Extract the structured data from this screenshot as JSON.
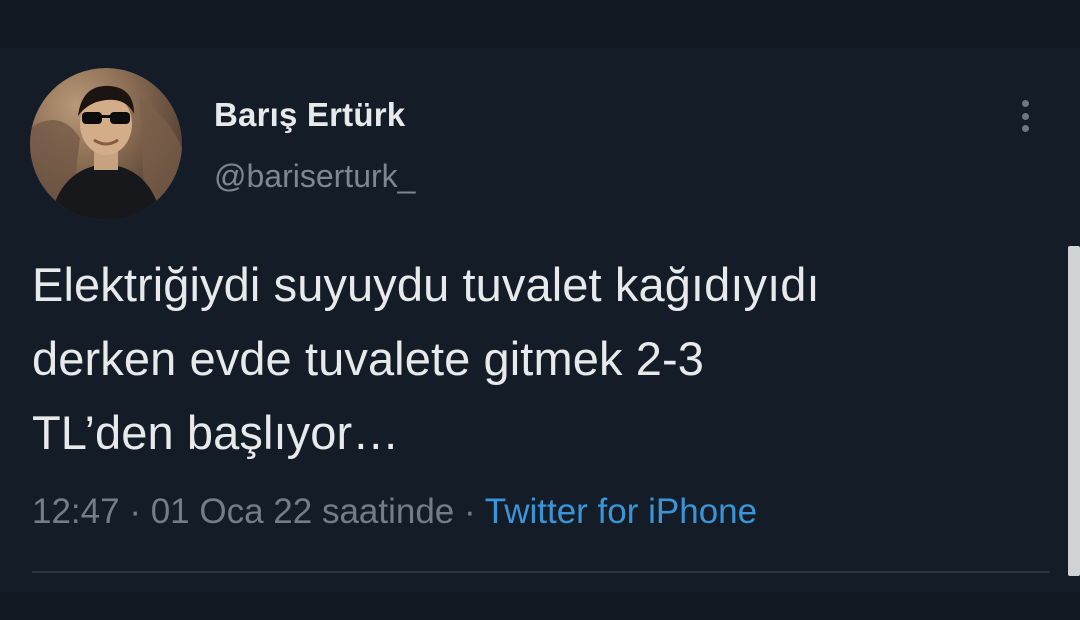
{
  "author": {
    "name": "Barış Ertürk",
    "handle": "@bariserturk_"
  },
  "tweet": {
    "lines": [
      "Elektriğiydi suyuydu tuvalet kağıdıyıdı",
      "derken evde tuvalete gitmek 2-3",
      "TL’den başlıyor…"
    ]
  },
  "meta": {
    "time": "12:47",
    "separator": "·",
    "date": "01 Oca 22 saatinde",
    "source": "Twitter for iPhone"
  },
  "colors": {
    "background": "#141c27",
    "text": "#e7e9ea",
    "muted": "#737d87",
    "link": "#3a95d8"
  },
  "icons": {
    "more": "more-vertical-icon"
  }
}
